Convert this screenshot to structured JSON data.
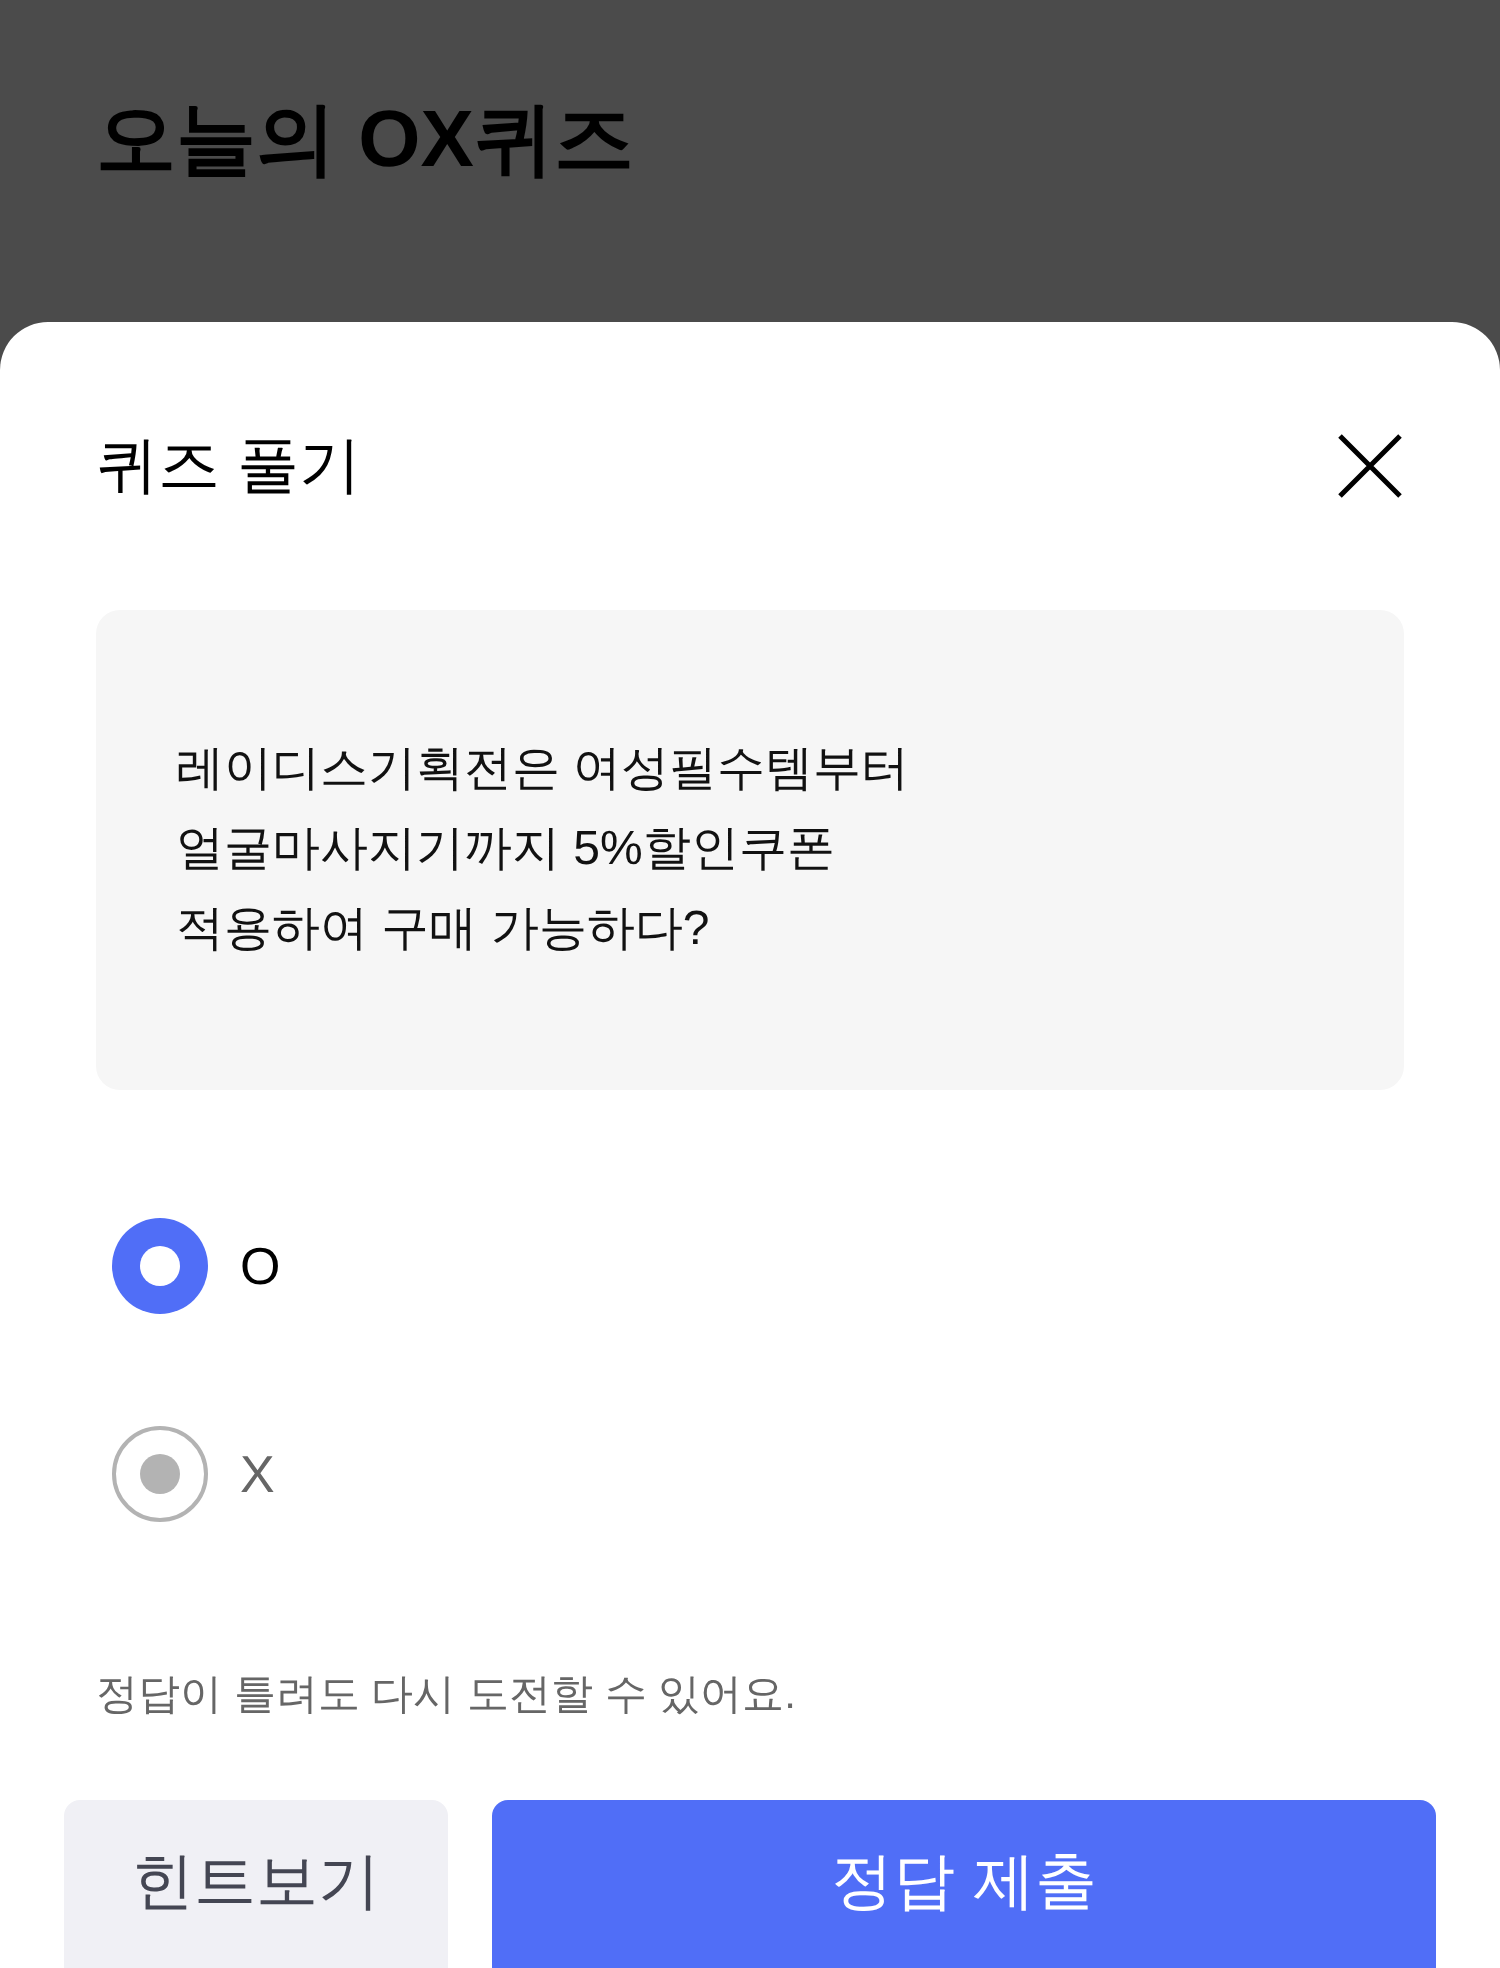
{
  "page": {
    "title": "오늘의 OX퀴즈"
  },
  "modal": {
    "title": "퀴즈 풀기",
    "question": "레이디스기획전은 여성필수템부터\n얼굴마사지기까지 5%할인쿠폰\n적용하여 구매 가능하다?",
    "options": [
      {
        "label": "O",
        "selected": true
      },
      {
        "label": "X",
        "selected": false
      }
    ],
    "notice": "정답이 틀려도 다시 도전할 수 있어요.",
    "buttons": [
      {
        "label": "힌트보기",
        "kind": "secondary"
      },
      {
        "label": "정답 제출",
        "kind": "primary"
      }
    ]
  }
}
